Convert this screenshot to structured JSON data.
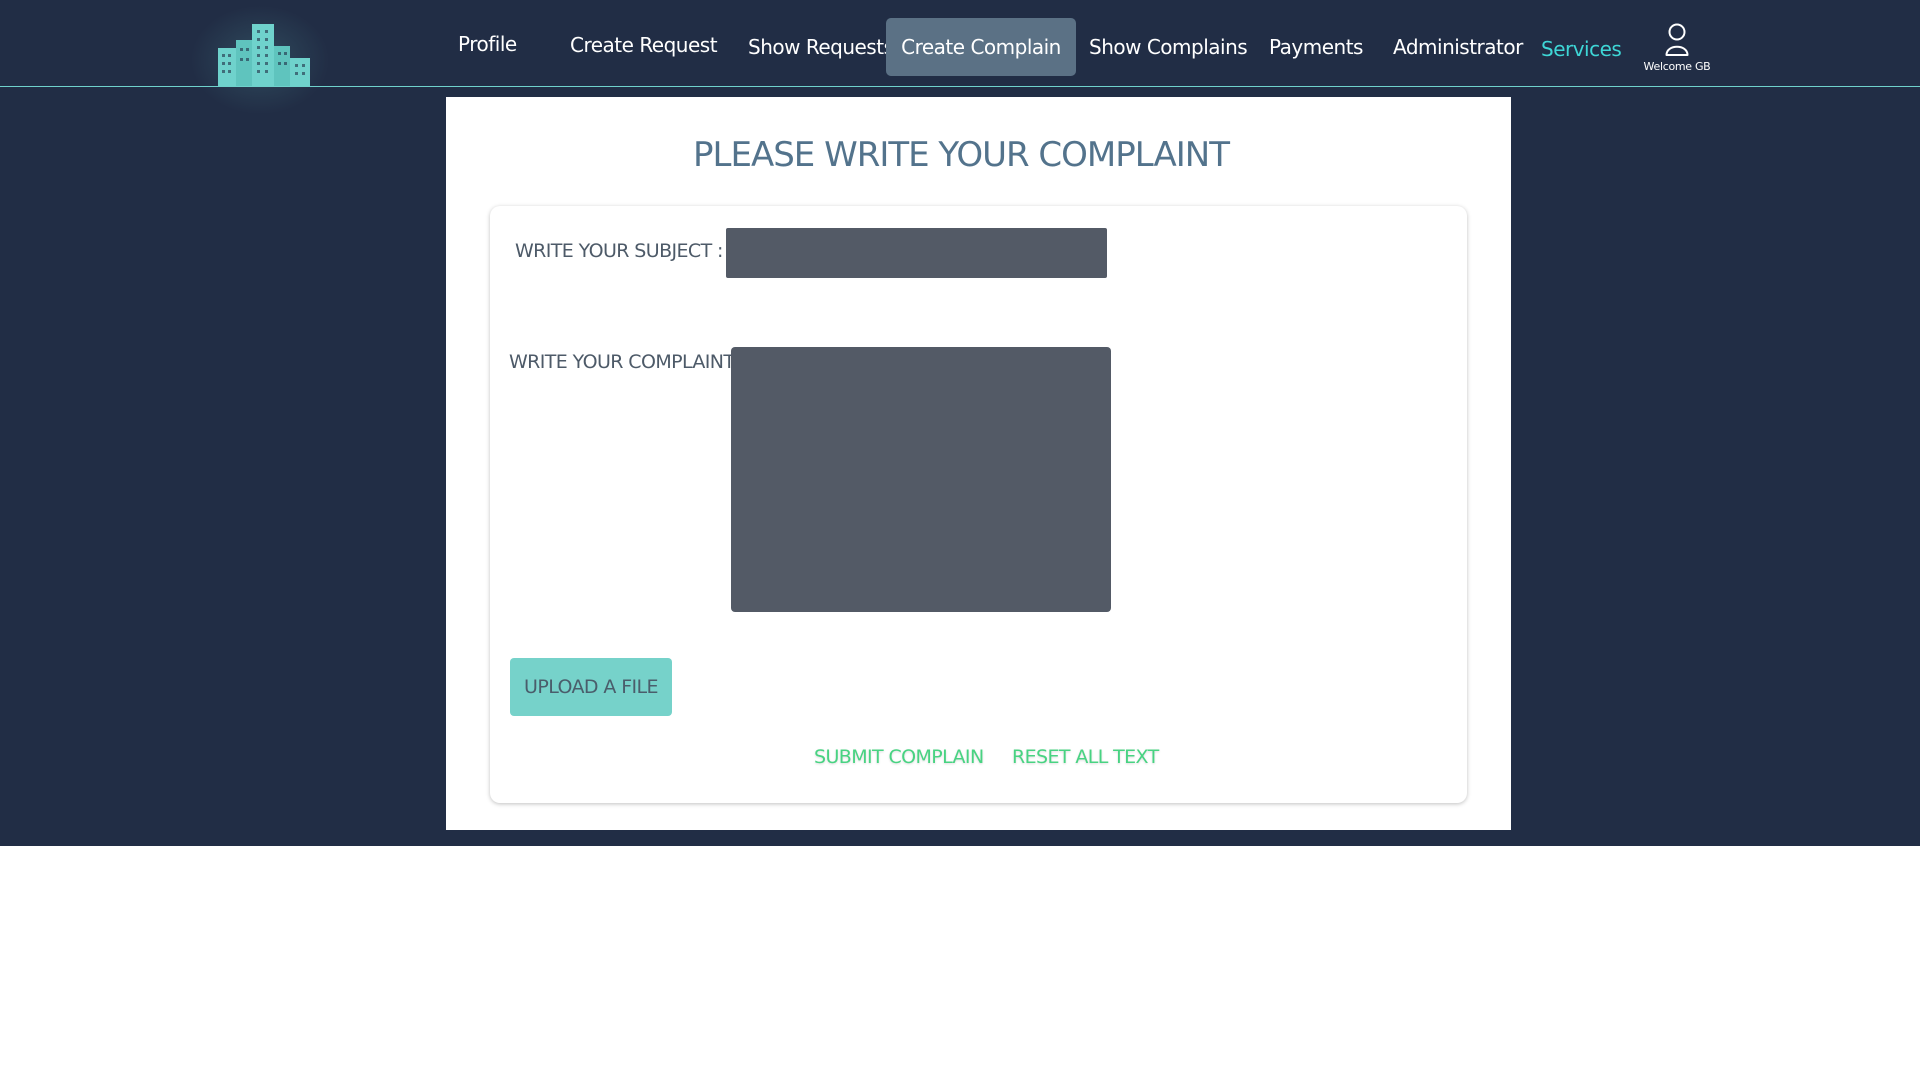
{
  "nav": {
    "items": [
      {
        "label": "Profile"
      },
      {
        "label": "Create Request"
      },
      {
        "label": "Show Requests"
      },
      {
        "label": "Create Complain"
      },
      {
        "label": "Show Complains"
      },
      {
        "label": "Payments"
      },
      {
        "label": "Administrator"
      },
      {
        "label": "Services"
      }
    ],
    "user_label": "Welcome GB"
  },
  "page": {
    "title": "PLEASE WRITE YOUR COMPLAINT",
    "subject_label": "WRITE YOUR SUBJECT :",
    "subject_value": "",
    "complaint_label": "WRITE YOUR COMPLAINT :",
    "complaint_value": "",
    "upload_label": "UPLOAD A FILE",
    "submit_label": "SUBMIT COMPLAIN",
    "reset_label": "RESET ALL TEXT"
  },
  "colors": {
    "background": "#212d45",
    "accent": "#6fd2cc",
    "active_nav": "#5b7185",
    "services": "#3ed6d6",
    "input_fill": "#535a66",
    "upload_button": "#76d2ca",
    "action_link": "#48d382",
    "title": "#53738c"
  },
  "icons": {
    "logo": "building-logo-icon",
    "user": "user-icon"
  }
}
